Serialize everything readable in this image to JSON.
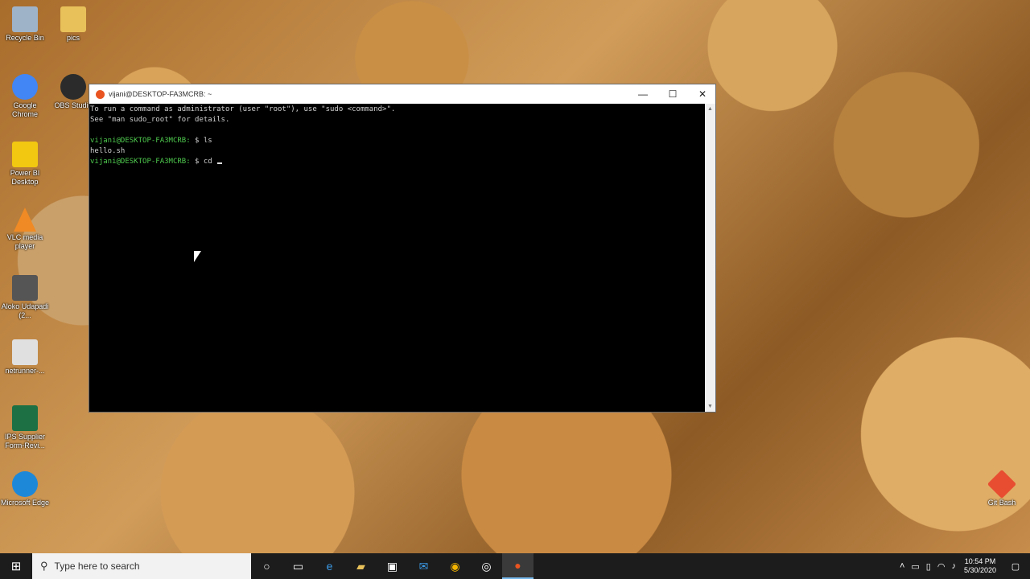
{
  "desktop": {
    "icons": [
      {
        "label": "Recycle Bin",
        "icon": "recycle-bin-icon",
        "color": "#9fb3c8"
      },
      {
        "label": "pics",
        "icon": "folder-icon",
        "color": "#e8c15a"
      },
      {
        "label": "Google Chrome",
        "icon": "chrome-icon",
        "color": "#4285f4"
      },
      {
        "label": "OBS Studio",
        "icon": "obs-icon",
        "color": "#2b2b2b"
      },
      {
        "label": "Power BI Desktop",
        "icon": "powerbi-icon",
        "color": "#f2c811"
      },
      {
        "label": "VLC media player",
        "icon": "vlc-icon",
        "color": "#f08a24"
      },
      {
        "label": "Aloko Udapadi (2...",
        "icon": "video-file-icon",
        "color": "#555555"
      },
      {
        "label": "netrunner-...",
        "icon": "disc-image-icon",
        "color": "#e0e0e0"
      },
      {
        "label": "IPS Supplier Form-Revi...",
        "icon": "excel-icon",
        "color": "#1d7044"
      },
      {
        "label": "Microsoft Edge",
        "icon": "edge-icon",
        "color": "#1e88d8"
      },
      {
        "label": "Git Bash",
        "icon": "git-bash-icon",
        "color": "#e84d31"
      }
    ]
  },
  "window": {
    "title": "vijani@DESKTOP-FA3MCRB: ~",
    "controls": {
      "minimize": "—",
      "maximize": "☐",
      "close": "✕"
    }
  },
  "terminal": {
    "lines": [
      {
        "text": "To run a command as administrator (user \"root\"), use \"sudo <command>\"."
      },
      {
        "text": "See \"man sudo_root\" for details."
      },
      {
        "text": ""
      },
      {
        "prompt": "vijani@DESKTOP-FA3MCRB:",
        "cmd": " $ ls"
      },
      {
        "text": "hello.sh"
      },
      {
        "prompt": "vijani@DESKTOP-FA3MCRB:",
        "cmd": " $ cd "
      }
    ]
  },
  "taskbar": {
    "search_placeholder": "Type here to search",
    "time": "10:54 PM",
    "date": "5/30/2020",
    "accent": "#76b9ed"
  }
}
